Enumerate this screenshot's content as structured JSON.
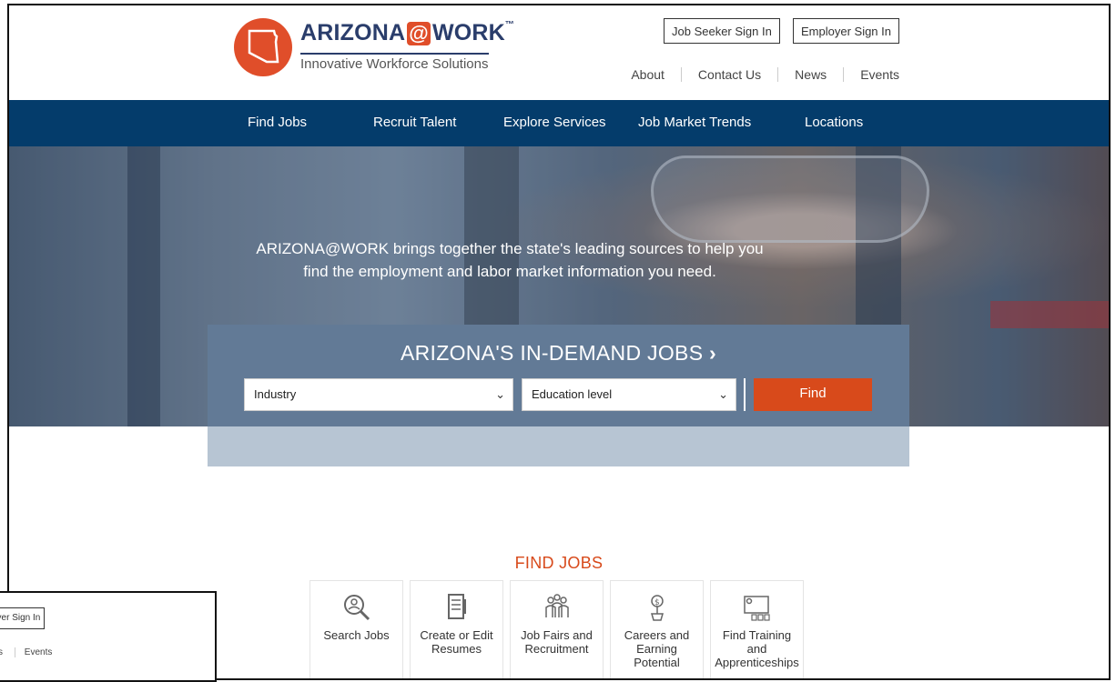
{
  "logo": {
    "word_left": "ARIZONA",
    "word_at": "@",
    "word_right": "WORK",
    "trademark": "™",
    "tagline": "Innovative Workforce Solutions"
  },
  "header": {
    "job_seeker_signin": "Job Seeker Sign In",
    "employer_signin": "Employer Sign In",
    "links": [
      "About",
      "Contact Us",
      "News",
      "Events"
    ]
  },
  "nav": {
    "items": [
      "Find Jobs",
      "Recruit Talent",
      "Explore Services",
      "Job Market Trends",
      "Locations"
    ]
  },
  "hero": {
    "text_line1": "ARIZONA@WORK brings together the state's leading sources to help you",
    "text_line2": "find the employment and labor market information you need."
  },
  "demand": {
    "title": "ARIZONA'S IN-DEMAND JOBS",
    "title_arrow": "›",
    "industry_select": "Industry",
    "education_select": "Education level",
    "find_label": "Find"
  },
  "find_jobs": {
    "title": "FIND JOBS",
    "tiles": [
      {
        "label": "Search Jobs",
        "icon": "magnifier-person-icon"
      },
      {
        "label": "Create or Edit Resumes",
        "icon": "resume-icon"
      },
      {
        "label": "Job Fairs and Recruitment",
        "icon": "group-icon"
      },
      {
        "label": "Careers and Earning Potential",
        "icon": "money-plant-icon"
      },
      {
        "label": "Find Training and Apprenticeships",
        "icon": "training-board-icon"
      }
    ]
  },
  "inset": {
    "signin_partial": "oyer Sign In",
    "links": [
      "s",
      "Events"
    ]
  },
  "colors": {
    "nav_bg": "#043c6b",
    "accent": "#d84a1b",
    "logo_navy": "#2a3d6b",
    "logo_orange": "#e04e2a"
  }
}
